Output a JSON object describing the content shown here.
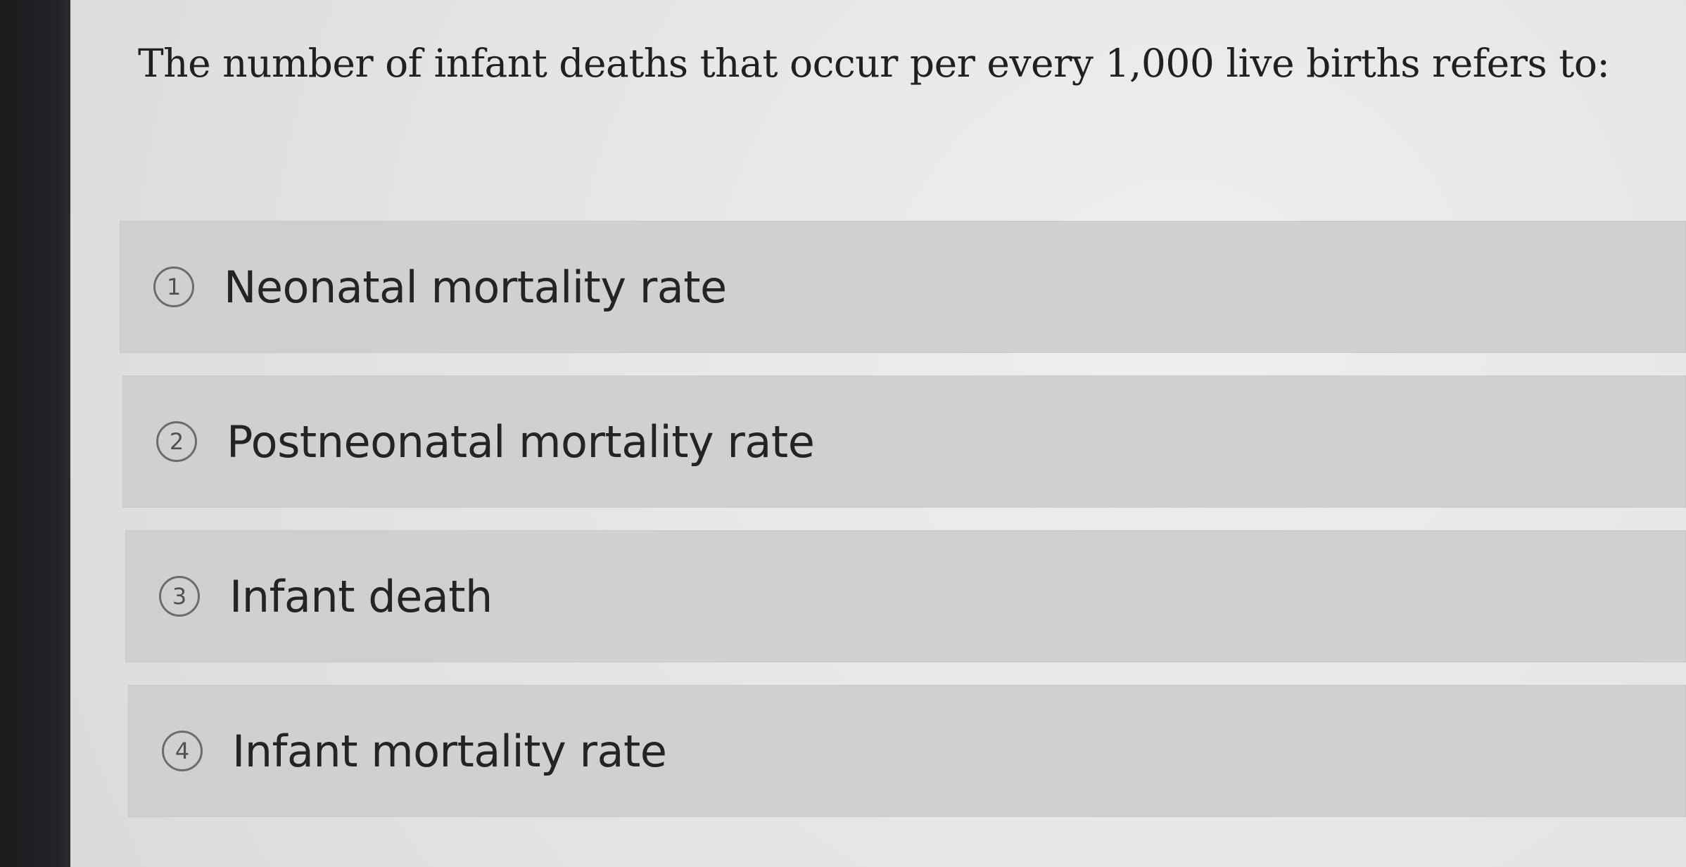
{
  "question": {
    "text": "The number of infant deaths that occur per every 1,000 live births refers to:"
  },
  "options": [
    {
      "number": "1",
      "label": "Neonatal mortality rate"
    },
    {
      "number": "2",
      "label": "Postneonatal mortality rate"
    },
    {
      "number": "3",
      "label": "Infant death"
    },
    {
      "number": "4",
      "label": "Infant mortality rate"
    }
  ]
}
